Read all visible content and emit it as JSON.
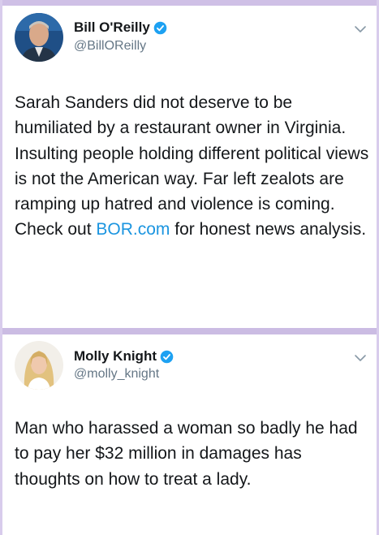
{
  "tweets": [
    {
      "author": {
        "display_name": "Bill O'Reilly",
        "handle": "@BillOReilly",
        "verified": true,
        "avatar_icon": "avatar-photo"
      },
      "menu_icon": "chevron-down-icon",
      "text": {
        "before_link": "Sarah Sanders did not deserve to be humiliated by a restaurant owner in Virginia. Insulting people holding different political views is not the American way. Far left zealots are ramping up hatred and violence is coming. Check out ",
        "link": "BOR.com",
        "after_link": " for honest news analysis."
      }
    },
    {
      "author": {
        "display_name": "Molly Knight",
        "handle": "@molly_knight",
        "verified": true,
        "avatar_icon": "avatar-photo"
      },
      "menu_icon": "chevron-down-icon",
      "text": {
        "body": "Man who harassed a woman so badly he had to pay her $32 million in damages has thoughts on how to treat a lady."
      }
    }
  ],
  "colors": {
    "link": "#1b95e0",
    "verified_badge": "#1da1f2",
    "handle": "#657786",
    "divider": "#cbbce3"
  }
}
